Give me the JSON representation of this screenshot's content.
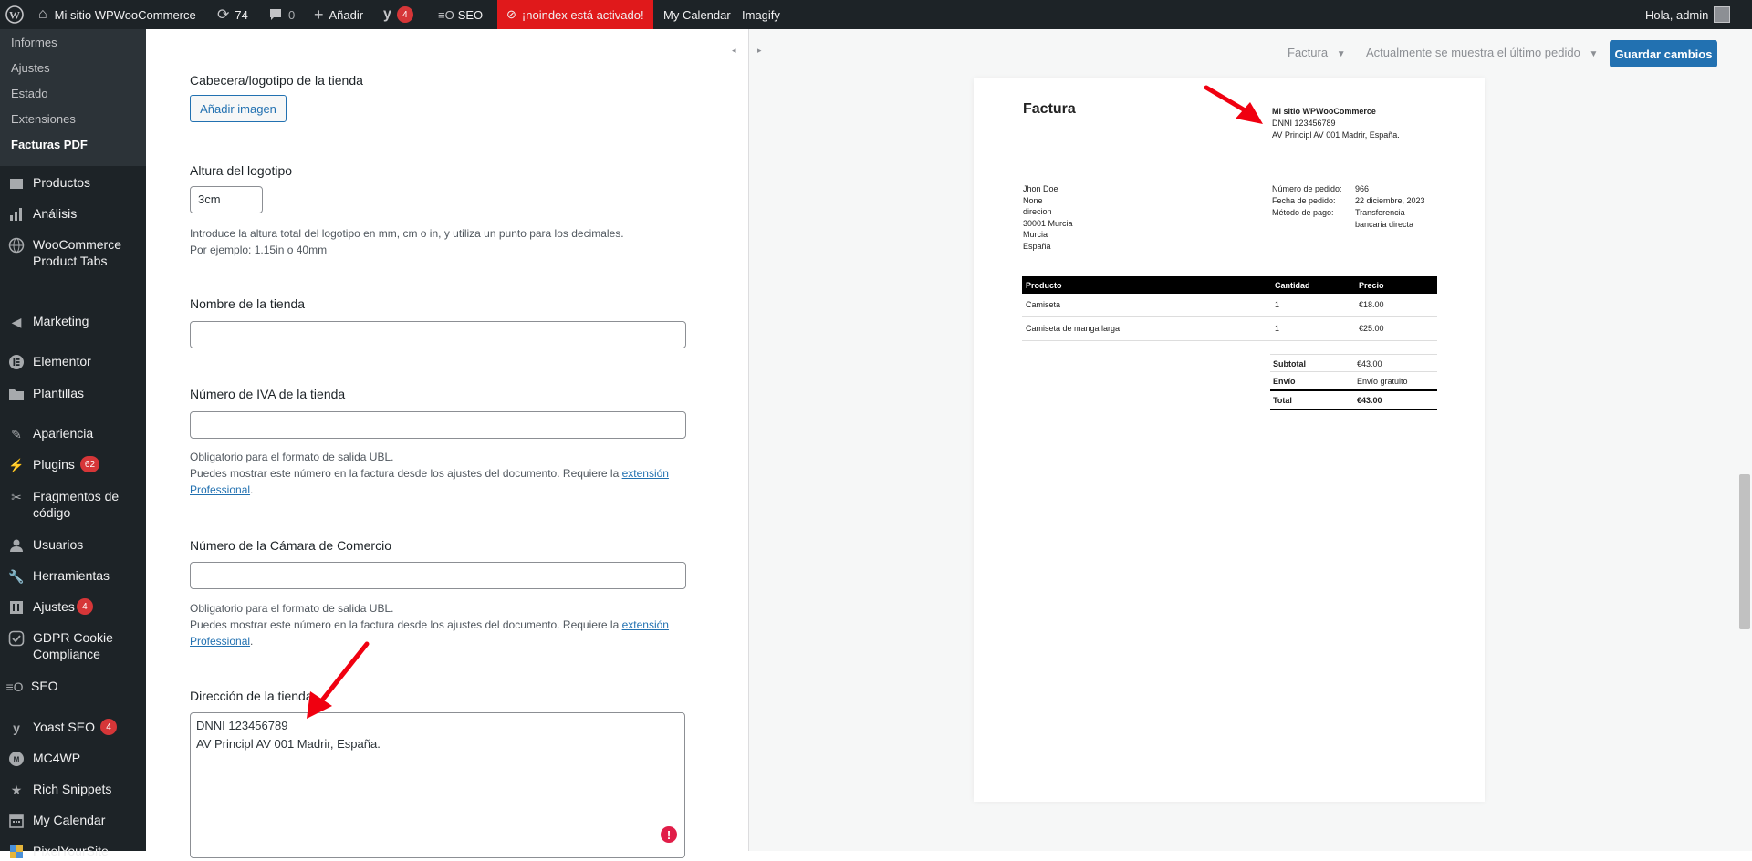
{
  "adminbar": {
    "site": "Mi sitio WPWooCommerce",
    "updates": "74",
    "comments": "0",
    "add": "Añadir",
    "yoast_count": "4",
    "seo": "SEO",
    "noindex": "¡noindex está activado!",
    "calendar": "My Calendar",
    "imagify": "Imagify",
    "greeting": "Hola, admin"
  },
  "sidebar": {
    "submenu": [
      "Informes",
      "Ajustes",
      "Estado",
      "Extensiones",
      "Facturas PDF"
    ],
    "items": [
      {
        "label": "Productos",
        "icon": "archive-icon"
      },
      {
        "label": "Análisis",
        "icon": "bar-chart-icon"
      },
      {
        "label": "WooCommerce Product Tabs",
        "icon": "globe-icon"
      },
      {
        "label": "Marketing",
        "icon": "megaphone-icon"
      },
      {
        "label": "Elementor",
        "icon": "elementor-icon"
      },
      {
        "label": "Plantillas",
        "icon": "folder-icon"
      },
      {
        "label": "Apariencia",
        "icon": "paintbrush-icon"
      },
      {
        "label": "Plugins",
        "icon": "plug-icon",
        "badge": "62"
      },
      {
        "label": "Fragmentos de código",
        "icon": "scissors-icon"
      },
      {
        "label": "Usuarios",
        "icon": "user-icon"
      },
      {
        "label": "Herramientas",
        "icon": "wrench-icon"
      },
      {
        "label": "Ajustes",
        "icon": "settings-icon",
        "badge": "4"
      },
      {
        "label": "GDPR Cookie Compliance",
        "icon": "check-shield-icon"
      },
      {
        "label": "SEO",
        "icon": "seo-icon"
      },
      {
        "label": "Yoast SEO",
        "icon": "yoast-icon",
        "badge": "4"
      },
      {
        "label": "MC4WP",
        "icon": "mailchimp-icon"
      },
      {
        "label": "Rich Snippets",
        "icon": "star-icon"
      },
      {
        "label": "My Calendar",
        "icon": "calendar-icon"
      },
      {
        "label": "PixelYourSite",
        "icon": "pixel-icon"
      }
    ]
  },
  "form": {
    "logo_label": "Cabecera/logotipo de la tienda",
    "add_image": "Añadir imagen",
    "logo_height_label": "Altura del logotipo",
    "logo_height_value": "3cm",
    "logo_help_1": "Introduce la altura total del logotipo en mm, cm o in, y utiliza un punto para los decimales.",
    "logo_help_2": "Por ejemplo: 1.15in o 40mm",
    "store_name_label": "Nombre de la tienda",
    "vat_label": "Número de IVA de la tienda",
    "vat_help_1": "Obligatorio para el formato de salida UBL.",
    "vat_help_2": "Puedes mostrar este número en la factura desde los ajustes del documento. Requiere la ",
    "vat_link_1": "extensión",
    "vat_link_2": "Professional",
    "coc_label": "Número de la Cámara de Comercio",
    "coc_help_1": "Obligatorio para el formato de salida UBL.",
    "coc_help_2": "Puedes mostrar este número en la factura desde los ajustes del documento. Requiere la ",
    "coc_link_1": "extensión",
    "coc_link_2": "Professional",
    "address_label": "Dirección de la tienda",
    "address_line_1": "DNNI 123456789",
    "address_line_2": "AV Principl AV 001 Madrir, España."
  },
  "preview": {
    "doc_select": "Factura",
    "order_select": "Actualmente se muestra el último pedido",
    "save": "Guardar cambios",
    "invoice": {
      "title": "Factura",
      "shop_name": "Mi sitio WPWooCommerce",
      "shop_line_1": "DNNI 123456789",
      "shop_line_2": "AV Principl AV 001 Madrir, España.",
      "customer": [
        "Jhon Doe",
        "None",
        "direcion",
        "30001 Murcia",
        "Murcia",
        "España"
      ],
      "order_number_label": "Número de pedido:",
      "order_number": "966",
      "order_date_label": "Fecha de pedido:",
      "order_date": "22 diciembre, 2023",
      "payment_label": "Método de pago:",
      "payment_1": "Transferencia",
      "payment_2": "bancaria directa",
      "col_product": "Producto",
      "col_qty": "Cantidad",
      "col_price": "Precio",
      "rows": [
        {
          "product": "Camiseta",
          "qty": "1",
          "price": "€18.00"
        },
        {
          "product": "Camiseta de manga larga",
          "qty": "1",
          "price": "€25.00"
        }
      ],
      "subtotal_label": "Subtotal",
      "subtotal": "€43.00",
      "shipping_label": "Envío",
      "shipping": "Envío gratuito",
      "total_label": "Total",
      "total": "€43.00"
    }
  },
  "colors": {
    "accent": "#2271b1",
    "adminbar": "#1d2327",
    "noindex": "#e0191b",
    "badge": "#d63638",
    "arrow": "#f00010"
  }
}
